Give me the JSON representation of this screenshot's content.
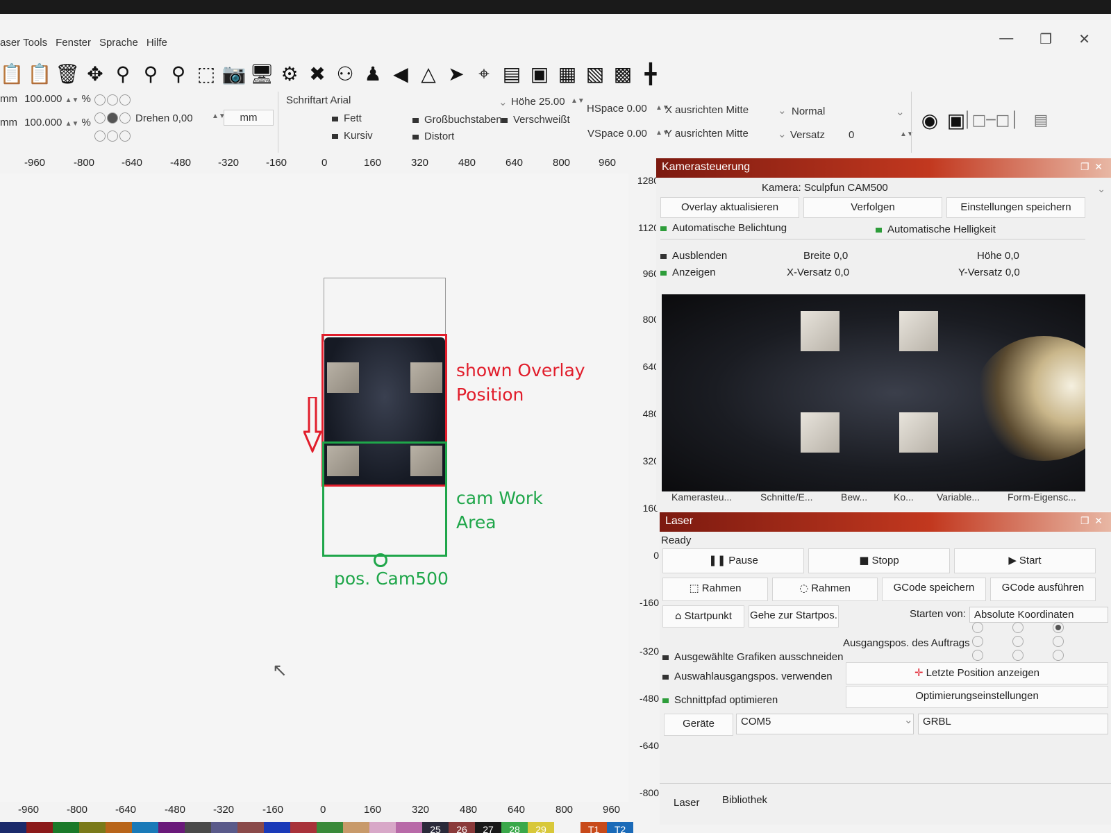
{
  "menu": [
    "aser Tools",
    "Fenster",
    "Sprache",
    "Hilfe"
  ],
  "props": {
    "width_unit": "mm",
    "width_pct": "100.000",
    "height_pct": "100.000",
    "pct": "%",
    "rotate": "Drehen 0,00",
    "unit": "mm",
    "font": "Schriftart Arial",
    "height": "Höhe 25.00",
    "bold": "Fett",
    "italic": "Kursiv",
    "upper": "Großbuchstaben",
    "welded": "Verschweißt",
    "distort": "Distort",
    "hspace": "HSpace 0.00",
    "vspace": "VSpace 0.00",
    "xalign": "X ausrichten Mitte",
    "yalign": "Y ausrichten Mitte",
    "mode": "Normal",
    "offset_label": "Versatz",
    "offset_value": "0"
  },
  "ruler_top": [
    "-960",
    "-800",
    "-640",
    "-480",
    "-320",
    "-160",
    "0",
    "160",
    "320",
    "480",
    "640",
    "800",
    "960"
  ],
  "ruler_right": [
    "1280",
    "1120",
    "960",
    "800",
    "640",
    "480",
    "320",
    "160",
    "0",
    "-160",
    "-320",
    "-480",
    "-640",
    "-800"
  ],
  "ruler_bottom": [
    "-960",
    "-800",
    "-640",
    "-480",
    "-320",
    "-160",
    "0",
    "160",
    "320",
    "480",
    "640",
    "800",
    "960"
  ],
  "annotations": {
    "overlay_line1": "shown Overlay",
    "overlay_line2": "Position",
    "work_line1": "cam Work",
    "work_line2": "Area",
    "cam_pos": "pos. Cam500"
  },
  "camera_panel": {
    "title": "Kamerasteuerung",
    "camera_label": "Kamera:",
    "camera_value": "Sculpfun CAM500",
    "btn_overlay": "Overlay aktualisieren",
    "btn_track": "Verfolgen",
    "btn_save": "Einstellungen speichern",
    "auto_exposure": "Automatische Belichtung",
    "auto_brightness": "Automatische Helligkeit",
    "hide": "Ausblenden",
    "show": "Anzeigen",
    "width": "Breite",
    "width_val": "0,0",
    "height": "Höhe",
    "height_val": "0,0",
    "xoff": "X-Versatz",
    "xoff_val": "0,0",
    "yoff": "Y-Versatz",
    "yoff_val": "0,0",
    "tabs": [
      "Kamerasteu...",
      "Schnitte/E...",
      "Bew...",
      "Ko...",
      "Variable...",
      "Form-Eigensc..."
    ]
  },
  "laser_panel": {
    "title": "Laser",
    "status": "Ready",
    "pause": "Pause",
    "stop": "Stopp",
    "start": "Start",
    "frame1": "Rahmen",
    "frame2": "Rahmen",
    "save_gcode": "GCode speichern",
    "run_gcode": "GCode ausführen",
    "home": "Startpunkt",
    "goto_start": "Gehe zur Startpos.",
    "start_from_label": "Starten von:",
    "start_from_value": "Absolute Koordinaten",
    "job_origin": "Ausgangspos. des Auftrags",
    "cut_selected": "Ausgewählte Grafiken ausschneiden",
    "use_sel_origin": "Auswahlausgangspos. verwenden",
    "optimize_path": "Schnittpfad optimieren",
    "show_last_pos": "Letzte Position anzeigen",
    "opt_settings": "Optimierungseinstellungen",
    "devices": "Geräte",
    "port": "COM5",
    "controller": "GRBL",
    "bottom_tabs": [
      "Laser",
      "Bibliothek"
    ]
  },
  "palette": [
    {
      "label": "",
      "color": "#1b2a6b"
    },
    {
      "label": "",
      "color": "#8b1a1a"
    },
    {
      "label": "",
      "color": "#1b7a2a"
    },
    {
      "label": "",
      "color": "#7a7a1a"
    },
    {
      "label": "",
      "color": "#b8651a"
    },
    {
      "label": "",
      "color": "#1a7ab8"
    },
    {
      "label": "",
      "color": "#6a1a7a"
    },
    {
      "label": "",
      "color": "#4a4a4a"
    },
    {
      "label": "",
      "color": "#5a5a8a"
    },
    {
      "label": "",
      "color": "#8a4a4a"
    },
    {
      "label": "",
      "color": "#1a3ab8"
    },
    {
      "label": "",
      "color": "#a8323a"
    },
    {
      "label": "",
      "color": "#3a8a3a"
    },
    {
      "label": "",
      "color": "#c89a6a"
    },
    {
      "label": "",
      "color": "#d8a8c8"
    },
    {
      "label": "",
      "color": "#b86aa8"
    },
    {
      "label": "25",
      "color": "#2a2a3a"
    },
    {
      "label": "26",
      "color": "#8a3a3a"
    },
    {
      "label": "27",
      "color": "#1a1a1a"
    },
    {
      "label": "28",
      "color": "#3aa84a"
    },
    {
      "label": "29",
      "color": "#d8c83a"
    },
    {
      "label": "",
      "color": "#f3f3f3"
    },
    {
      "label": "T1",
      "color": "#c84a1a"
    },
    {
      "label": "T2",
      "color": "#1a6ab8"
    }
  ]
}
